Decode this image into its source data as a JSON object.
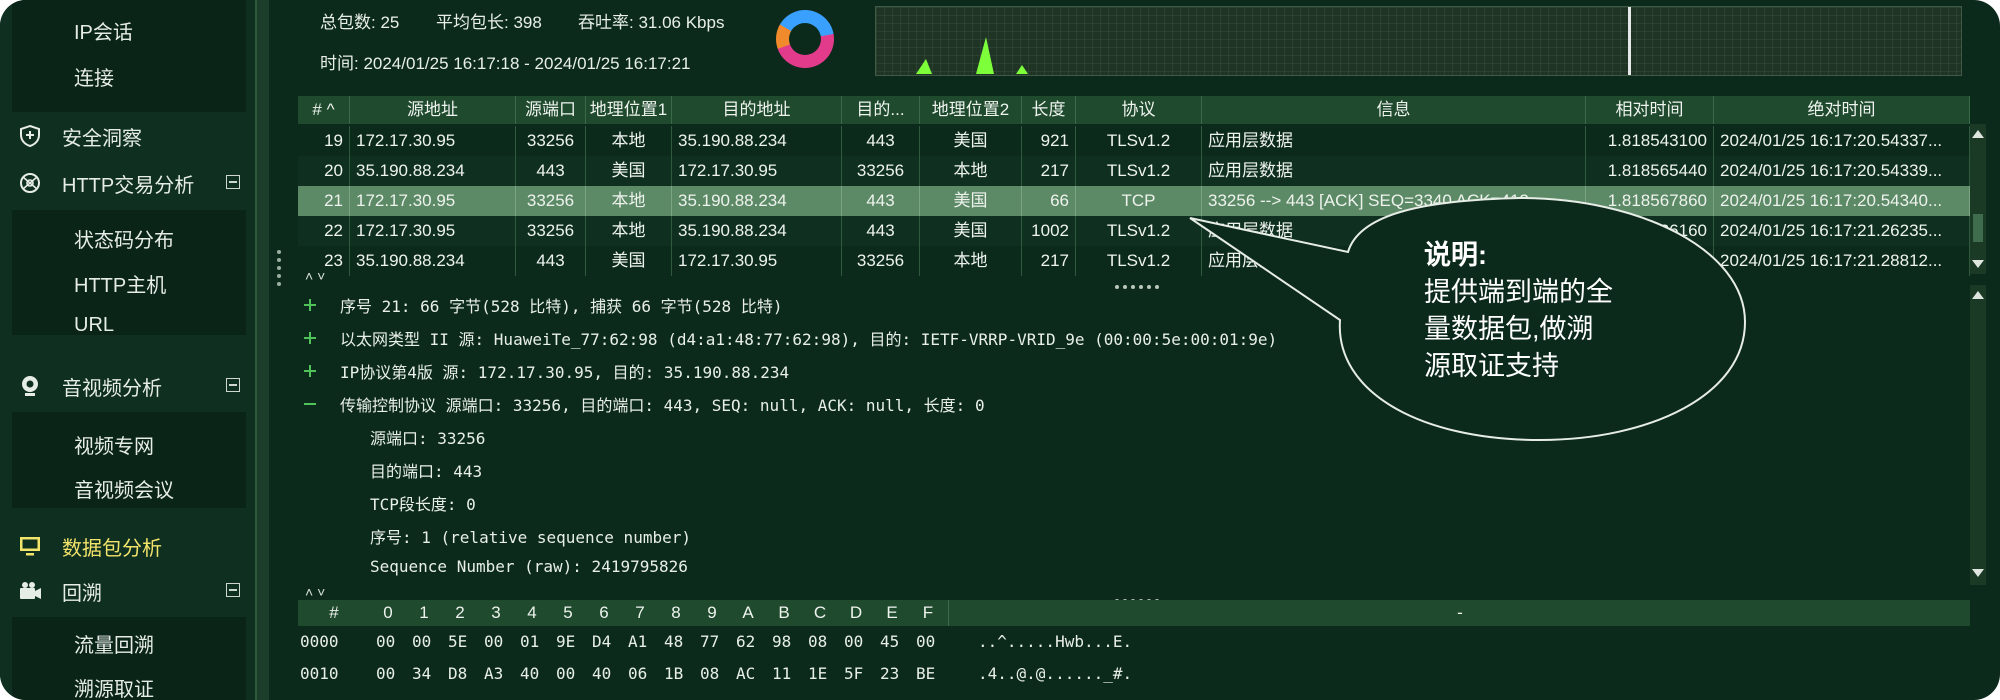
{
  "sidebar": {
    "top_items": [
      "IP会话",
      "连接"
    ],
    "sections": [
      {
        "label": "安全洞察",
        "icon": "shield-icon",
        "collapsible": false
      },
      {
        "label": "HTTP交易分析",
        "icon": "network-globe-icon",
        "collapsible": true
      },
      {
        "label": "音视频分析",
        "icon": "webcam-icon",
        "collapsible": true
      },
      {
        "label": "数据包分析",
        "icon": "monitor-icon",
        "collapsible": false,
        "active": true
      },
      {
        "label": "回溯",
        "icon": "video-camera-icon",
        "collapsible": true
      }
    ],
    "http_sub": [
      "状态码分布",
      "HTTP主机",
      "URL"
    ],
    "av_sub": [
      "视频专网",
      "音视频会议"
    ],
    "trace_sub": [
      "流量回溯",
      "溯源取证"
    ]
  },
  "stats": {
    "total_packets": "总包数: 25",
    "avg_len": "平均包长: 398",
    "throughput": "吞吐率: 31.06 Kbps",
    "time_range": "时间: 2024/01/25 16:17:18 - 2024/01/25 16:17:21"
  },
  "packet_table": {
    "columns": [
      "#",
      "源地址",
      "源端口",
      "地理位置1",
      "目的地址",
      "目的...",
      "地理位置2",
      "长度",
      "协议",
      "信息",
      "相对时间",
      "绝对时间"
    ],
    "rows": [
      [
        "19",
        "172.17.30.95",
        "33256",
        "本地",
        "35.190.88.234",
        "443",
        "美国",
        "921",
        "TLSv1.2",
        "应用层数据",
        "1.818543100",
        "2024/01/25 16:17:20.54337..."
      ],
      [
        "20",
        "35.190.88.234",
        "443",
        "美国",
        "172.17.30.95",
        "33256",
        "本地",
        "217",
        "TLSv1.2",
        "应用层数据",
        "1.818565440",
        "2024/01/25 16:17:20.54339..."
      ],
      [
        "21",
        "172.17.30.95",
        "33256",
        "本地",
        "35.190.88.234",
        "443",
        "美国",
        "66",
        "TCP",
        "33256 --> 443 [ACK] SEQ=3340 ACK=412...",
        "1.818567860",
        "2024/01/25 16:17:20.54340..."
      ],
      [
        "22",
        "172.17.30.95",
        "33256",
        "本地",
        "35.190.88.234",
        "443",
        "美国",
        "1002",
        "TLSv1.2",
        "应用层数据",
        "1.8197526160",
        "2024/01/25 16:17:21.26235..."
      ],
      [
        "23",
        "35.190.88.234",
        "443",
        "美国",
        "172.17.30.95",
        "33256",
        "本地",
        "217",
        "TLSv1.2",
        "应用层数据",
        "1.8197526160",
        "2024/01/25 16:17:21.28812..."
      ]
    ],
    "selected_index": 2
  },
  "detail": {
    "lines": [
      {
        "text": "序号 21: 66 字节(528 比特), 捕获 66 字节(528 比特)",
        "indent": 0,
        "toggle": "plus"
      },
      {
        "text": "以太网类型 II 源: HuaweiTe_77:62:98 (d4:a1:48:77:62:98), 目的: IETF-VRRP-VRID_9e (00:00:5e:00:01:9e)",
        "indent": 0,
        "toggle": "plus"
      },
      {
        "text": "IP协议第4版 源: 172.17.30.95, 目的: 35.190.88.234",
        "indent": 0,
        "toggle": "plus"
      },
      {
        "text": "传输控制协议 源端口: 33256, 目的端口: 443, SEQ: null, ACK: null, 长度: 0",
        "indent": 0,
        "toggle": "minus"
      },
      {
        "text": "源端口: 33256",
        "indent": 1,
        "toggle": ""
      },
      {
        "text": "目的端口: 443",
        "indent": 1,
        "toggle": ""
      },
      {
        "text": "TCP段长度: 0",
        "indent": 1,
        "toggle": ""
      },
      {
        "text": "序号: 1    (relative sequence number)",
        "indent": 1,
        "toggle": ""
      },
      {
        "text": "Sequence Number (raw): 2419795826",
        "indent": 1,
        "toggle": ""
      }
    ]
  },
  "hex": {
    "header": [
      "#",
      "0",
      "1",
      "2",
      "3",
      "4",
      "5",
      "6",
      "7",
      "8",
      "9",
      "A",
      "B",
      "C",
      "D",
      "E",
      "F",
      "-"
    ],
    "rows": [
      {
        "offset": "0000",
        "bytes": [
          "00",
          "00",
          "5E",
          "00",
          "01",
          "9E",
          "D4",
          "A1",
          "48",
          "77",
          "62",
          "98",
          "08",
          "00",
          "45",
          "00"
        ],
        "ascii": "..^.....Hwb...E."
      },
      {
        "offset": "0010",
        "bytes": [
          "00",
          "34",
          "D8",
          "A3",
          "40",
          "00",
          "40",
          "06",
          "1B",
          "08",
          "AC",
          "11",
          "1E",
          "5F",
          "23",
          "BE"
        ],
        "ascii": ".4..@.@......_#."
      }
    ]
  },
  "callout": {
    "title": "说明:",
    "lines": [
      "提供端到端的全",
      "量数据包,做溯",
      "源取证支持"
    ]
  },
  "colors": {
    "background": "#0c2a1c",
    "header": "#1f4a2e",
    "selected_row": "#5d8a66",
    "active_nav": "#f2e46a",
    "sparkline": "#7dff3a"
  }
}
